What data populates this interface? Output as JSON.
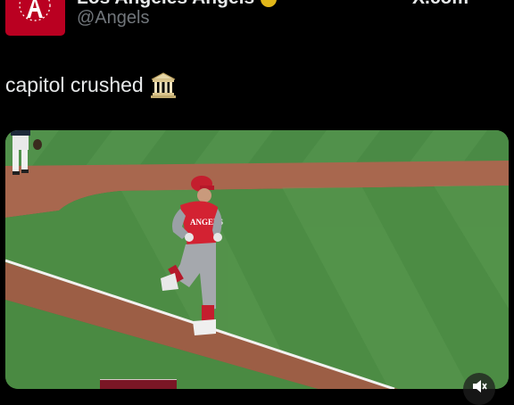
{
  "post": {
    "account_name": "Los Angeles Angels",
    "handle": "@Angels",
    "text": "capitol crushed",
    "emoji_icon": "classical-building-icon",
    "avatar_icon": "angels-logo-icon"
  },
  "brand": {
    "platform_logo": "X.com"
  },
  "colors": {
    "background": "#000000",
    "text_primary": "#e7e9ea",
    "text_secondary": "#71767b",
    "angels_red": "#ba0021",
    "verified_gold": "#e2b719"
  }
}
